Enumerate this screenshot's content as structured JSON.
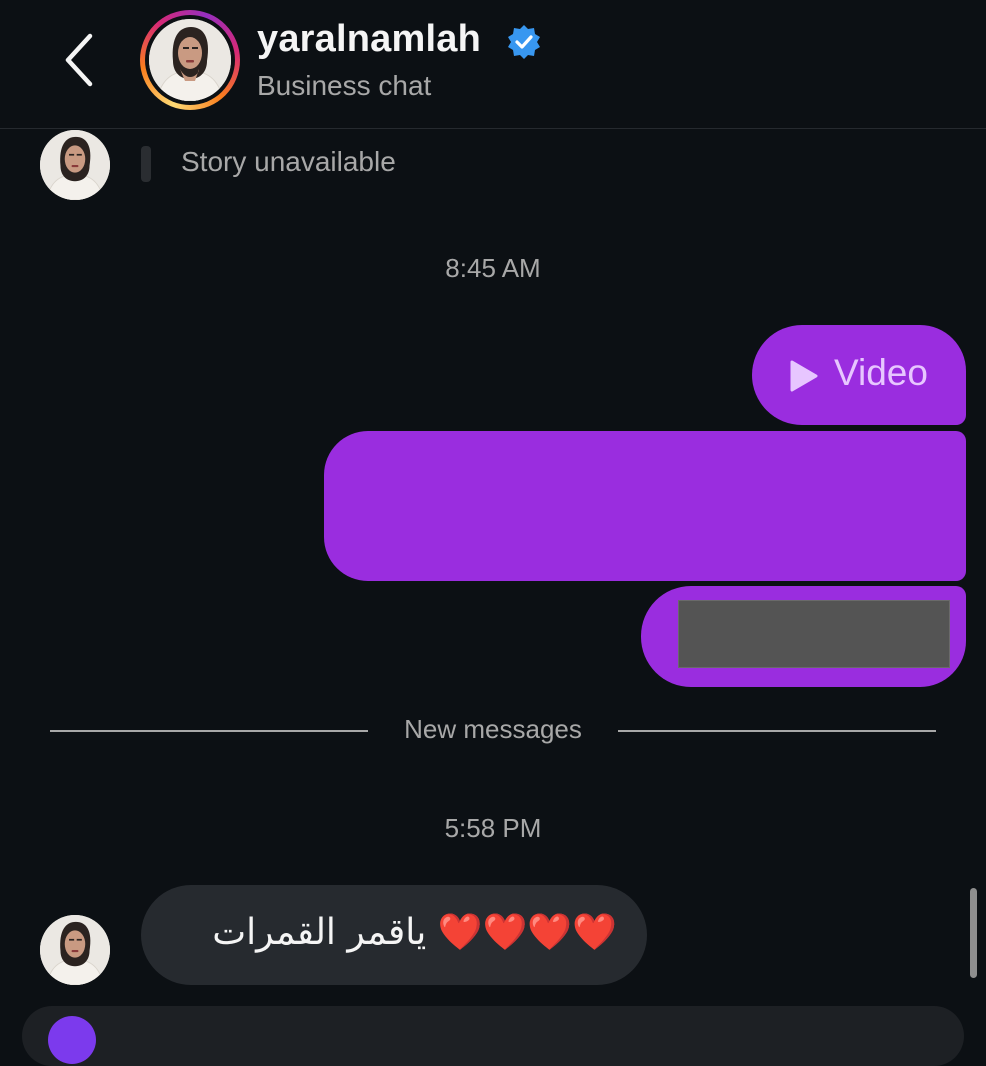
{
  "header": {
    "username": "yaralnamlah",
    "subtitle": "Business chat"
  },
  "story": {
    "text": "Story unavailable"
  },
  "messages": {
    "time_1": "8:45 AM",
    "video_label": "Video",
    "divider_label": "New messages",
    "time_2": "5:58 PM",
    "incoming_text": "❤️❤️❤️❤️ ياقمر القمرات"
  },
  "colors": {
    "background": "#0c1014",
    "outgoing_bubble": "#9a2ddf",
    "incoming_bubble": "#262a2f",
    "verified_badge": "#3897f0"
  },
  "icons": {
    "back": "chevron-left-icon",
    "verified": "verified-badge-icon",
    "play": "play-icon"
  }
}
